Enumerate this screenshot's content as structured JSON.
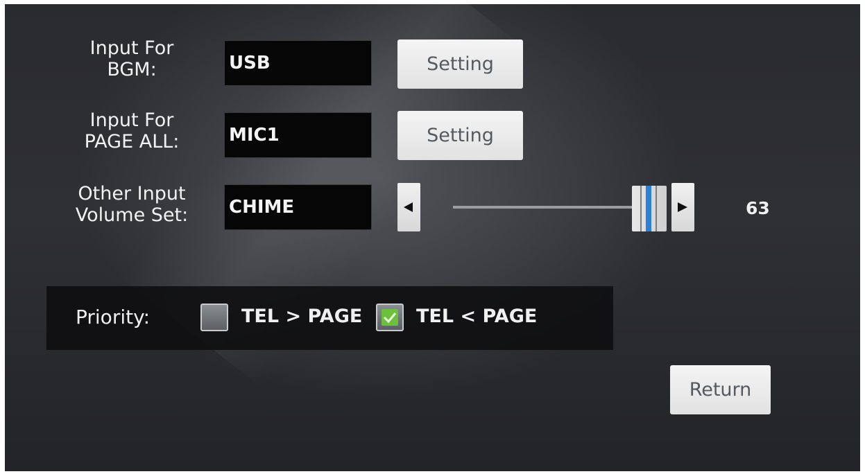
{
  "bgm": {
    "label_line1": "Input For",
    "label_line2": "BGM:",
    "value": "USB",
    "button": "Setting"
  },
  "page_all": {
    "label_line1": "Input For",
    "label_line2": "PAGE ALL:",
    "value": "MIC1",
    "button": "Setting"
  },
  "other": {
    "label_line1": "Other Input",
    "label_line2": "Volume Set:",
    "value": "CHIME",
    "volume": "63",
    "slider_level": 0.95
  },
  "priority": {
    "label": "Priority:",
    "options": [
      {
        "label": "TEL > PAGE",
        "checked": false
      },
      {
        "label": "TEL < PAGE",
        "checked": true
      }
    ]
  },
  "return_label": "Return",
  "colors": {
    "slider_thumb_center": "#2f7fd6",
    "checkmark": "#6cc13a",
    "field_bg": "#060606"
  }
}
